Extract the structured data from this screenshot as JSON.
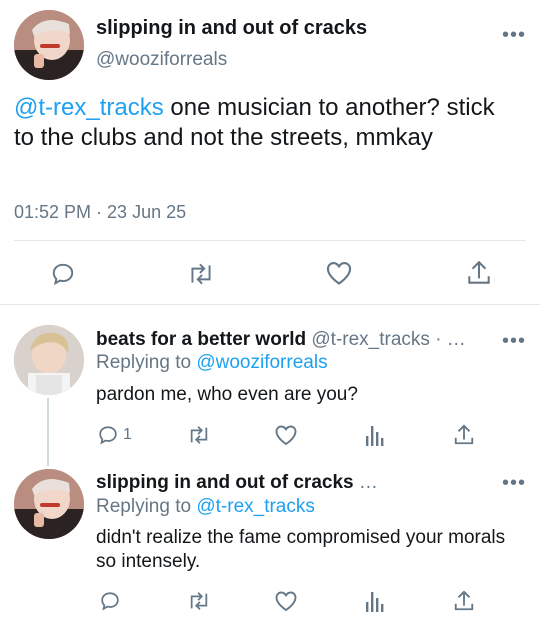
{
  "main_tweet": {
    "display_name": "slipping in and out of cracks",
    "handle": "@wooziforreals",
    "mention": "@t-rex_tracks",
    "text": " one musician to another? stick to the clubs and not the streets, mmkay",
    "timestamp": "01:52 PM · 23 Jun 25",
    "more_label": "•••"
  },
  "replies": [
    {
      "display_name": "beats for a better world",
      "handle": "@t-rex_tracks · …",
      "replying_prefix": "Replying to ",
      "replying_to": "@wooziforreals",
      "text": "pardon me, who even are you?",
      "reply_count": "1",
      "more_label": "•••"
    },
    {
      "display_name": "slipping in and out of cracks",
      "handle": " …",
      "replying_prefix": "Replying to ",
      "replying_to": "@t-rex_tracks",
      "text": "didn't realize the fame compromised your morals so intensely.",
      "more_label": "•••"
    }
  ],
  "colors": {
    "accent": "#1da1f2",
    "secondary_text": "#657786",
    "divider": "#e1e8ed"
  },
  "icons": [
    "reply-icon",
    "retweet-icon",
    "like-icon",
    "share-icon",
    "analytics-icon",
    "more-icon"
  ]
}
